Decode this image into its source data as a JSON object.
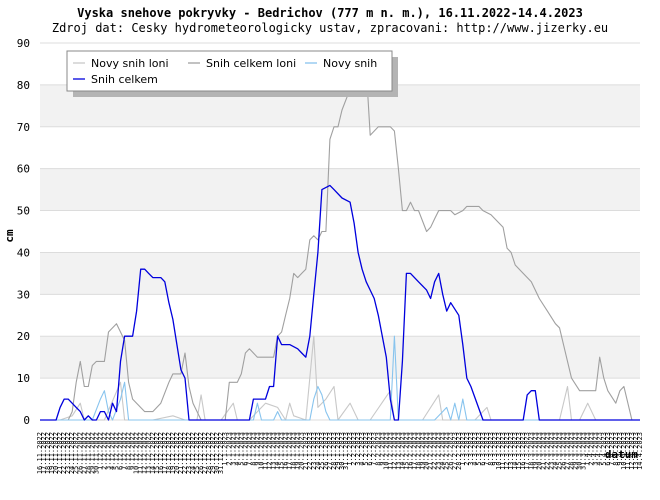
{
  "chart_data": {
    "type": "line",
    "title": "Vyska snehove pokryvky - Bedrichov (777 m n. m.), 16.11.2022-14.4.2023",
    "subtitle": "Zdroj dat: Cesky hydrometeorologicky ustav, zpracovani: http://www.jizerky.eu",
    "ylabel": "cm",
    "xlabel": "datum",
    "ylim": [
      0,
      90
    ],
    "yticks": [
      0,
      10,
      20,
      30,
      40,
      50,
      60,
      70,
      80,
      90
    ],
    "grid": true,
    "legend_position": "top-left",
    "x_start": "16.11.2022",
    "x_end": "14.4.2023",
    "series": [
      {
        "name": "Novy snih loni",
        "color": "#c8c8c8",
        "values": [
          [
            0,
            0
          ],
          [
            5,
            0
          ],
          [
            8,
            1
          ],
          [
            10,
            4
          ],
          [
            11,
            0
          ],
          [
            13,
            0
          ],
          [
            16,
            0
          ],
          [
            20,
            9
          ],
          [
            21,
            0
          ],
          [
            28,
            0
          ],
          [
            33,
            1
          ],
          [
            36,
            0
          ],
          [
            39,
            0
          ],
          [
            40,
            6
          ],
          [
            41,
            0
          ],
          [
            45,
            0
          ],
          [
            48,
            4
          ],
          [
            49,
            0
          ],
          [
            52,
            0
          ],
          [
            56,
            4
          ],
          [
            59,
            3
          ],
          [
            61,
            0
          ],
          [
            62,
            4
          ],
          [
            63,
            1
          ],
          [
            66,
            0
          ],
          [
            68,
            20
          ],
          [
            69,
            3
          ],
          [
            71,
            5
          ],
          [
            73,
            8
          ],
          [
            74,
            0
          ],
          [
            77,
            4
          ],
          [
            79,
            0
          ],
          [
            82,
            0
          ],
          [
            87,
            7
          ],
          [
            88,
            0
          ],
          [
            95,
            0
          ],
          [
            99,
            6
          ],
          [
            100,
            0
          ],
          [
            108,
            0
          ],
          [
            111,
            3
          ],
          [
            112,
            0
          ],
          [
            129,
            0
          ],
          [
            131,
            8
          ],
          [
            132,
            0
          ],
          [
            134,
            0
          ],
          [
            136,
            4
          ],
          [
            138,
            0
          ],
          [
            149,
            0
          ]
        ]
      },
      {
        "name": "Snih celkem loni",
        "color": "#a0a0a0",
        "values": [
          [
            0,
            0
          ],
          [
            7,
            0
          ],
          [
            8,
            2
          ],
          [
            9,
            9
          ],
          [
            10,
            14
          ],
          [
            11,
            8
          ],
          [
            12,
            8
          ],
          [
            13,
            13
          ],
          [
            14,
            14
          ],
          [
            16,
            14
          ],
          [
            17,
            21
          ],
          [
            19,
            23
          ],
          [
            21,
            19
          ],
          [
            22,
            9
          ],
          [
            23,
            5
          ],
          [
            24,
            4
          ],
          [
            26,
            2
          ],
          [
            28,
            2
          ],
          [
            30,
            4
          ],
          [
            32,
            9
          ],
          [
            33,
            11
          ],
          [
            35,
            11
          ],
          [
            36,
            16
          ],
          [
            37,
            8
          ],
          [
            38,
            4
          ],
          [
            40,
            0
          ],
          [
            46,
            0
          ],
          [
            47,
            9
          ],
          [
            49,
            9
          ],
          [
            50,
            11
          ],
          [
            51,
            16
          ],
          [
            52,
            17
          ],
          [
            54,
            15
          ],
          [
            58,
            15
          ],
          [
            59,
            20
          ],
          [
            60,
            21
          ],
          [
            61,
            25
          ],
          [
            62,
            29
          ],
          [
            63,
            35
          ],
          [
            64,
            34
          ],
          [
            65,
            35
          ],
          [
            66,
            36
          ],
          [
            67,
            43
          ],
          [
            68,
            44
          ],
          [
            69,
            43
          ],
          [
            70,
            45
          ],
          [
            71,
            45
          ],
          [
            72,
            67
          ],
          [
            73,
            70
          ],
          [
            74,
            70
          ],
          [
            75,
            74
          ],
          [
            77,
            79
          ],
          [
            78,
            80
          ],
          [
            79,
            80
          ],
          [
            81,
            84
          ],
          [
            82,
            68
          ],
          [
            84,
            70
          ],
          [
            87,
            70
          ],
          [
            88,
            69
          ],
          [
            89,
            60
          ],
          [
            90,
            50
          ],
          [
            91,
            50
          ],
          [
            92,
            52
          ],
          [
            93,
            50
          ],
          [
            94,
            50
          ],
          [
            96,
            45
          ],
          [
            97,
            46
          ],
          [
            98,
            48
          ],
          [
            99,
            50
          ],
          [
            102,
            50
          ],
          [
            103,
            49
          ],
          [
            105,
            50
          ],
          [
            106,
            51
          ],
          [
            109,
            51
          ],
          [
            110,
            50
          ],
          [
            112,
            49
          ],
          [
            114,
            47
          ],
          [
            115,
            46
          ],
          [
            116,
            41
          ],
          [
            117,
            40
          ],
          [
            118,
            37
          ],
          [
            120,
            35
          ],
          [
            122,
            33
          ],
          [
            124,
            29
          ],
          [
            126,
            26
          ],
          [
            128,
            23
          ],
          [
            129,
            22
          ],
          [
            130,
            18
          ],
          [
            132,
            10
          ],
          [
            134,
            7
          ],
          [
            138,
            7
          ],
          [
            139,
            15
          ],
          [
            140,
            10
          ],
          [
            141,
            7
          ],
          [
            143,
            4
          ],
          [
            144,
            7
          ],
          [
            145,
            8
          ],
          [
            146,
            4
          ],
          [
            147,
            0
          ],
          [
            149,
            0
          ]
        ]
      },
      {
        "name": "Novy snih",
        "color": "#88c4ee",
        "values": [
          [
            0,
            0
          ],
          [
            13,
            0
          ],
          [
            15,
            5
          ],
          [
            16,
            7
          ],
          [
            17,
            2
          ],
          [
            18,
            0
          ],
          [
            20,
            5
          ],
          [
            21,
            9
          ],
          [
            22,
            0
          ],
          [
            53,
            0
          ],
          [
            54,
            4
          ],
          [
            55,
            0
          ],
          [
            58,
            0
          ],
          [
            59,
            2
          ],
          [
            60,
            0
          ],
          [
            67,
            0
          ],
          [
            68,
            5
          ],
          [
            69,
            8
          ],
          [
            70,
            6
          ],
          [
            71,
            2
          ],
          [
            72,
            0
          ],
          [
            87,
            0
          ],
          [
            88,
            20
          ],
          [
            89,
            0
          ],
          [
            98,
            0
          ],
          [
            99,
            1
          ],
          [
            100,
            2
          ],
          [
            101,
            3
          ],
          [
            102,
            0
          ],
          [
            103,
            4
          ],
          [
            104,
            0
          ],
          [
            105,
            5
          ],
          [
            106,
            0
          ],
          [
            149,
            0
          ]
        ]
      },
      {
        "name": "Snih celkem",
        "color": "#0000dd",
        "values": [
          [
            0,
            0
          ],
          [
            4,
            0
          ],
          [
            5,
            3
          ],
          [
            6,
            5
          ],
          [
            7,
            5
          ],
          [
            9,
            3
          ],
          [
            10,
            2
          ],
          [
            11,
            0
          ],
          [
            12,
            1
          ],
          [
            13,
            0
          ],
          [
            14,
            0
          ],
          [
            15,
            2
          ],
          [
            16,
            2
          ],
          [
            17,
            0
          ],
          [
            18,
            4
          ],
          [
            19,
            2
          ],
          [
            20,
            14
          ],
          [
            21,
            20
          ],
          [
            23,
            20
          ],
          [
            24,
            26
          ],
          [
            25,
            36
          ],
          [
            26,
            36
          ],
          [
            27,
            35
          ],
          [
            28,
            34
          ],
          [
            30,
            34
          ],
          [
            31,
            33
          ],
          [
            32,
            28
          ],
          [
            33,
            24
          ],
          [
            34,
            18
          ],
          [
            35,
            12
          ],
          [
            36,
            10
          ],
          [
            37,
            0
          ],
          [
            52,
            0
          ],
          [
            53,
            5
          ],
          [
            56,
            5
          ],
          [
            57,
            8
          ],
          [
            58,
            8
          ],
          [
            59,
            20
          ],
          [
            60,
            18
          ],
          [
            62,
            18
          ],
          [
            64,
            17
          ],
          [
            65,
            16
          ],
          [
            66,
            15
          ],
          [
            67,
            20
          ],
          [
            68,
            30
          ],
          [
            69,
            40
          ],
          [
            70,
            55
          ],
          [
            72,
            56
          ],
          [
            73,
            55
          ],
          [
            75,
            53
          ],
          [
            77,
            52
          ],
          [
            78,
            47
          ],
          [
            79,
            40
          ],
          [
            80,
            36
          ],
          [
            81,
            33
          ],
          [
            82,
            31
          ],
          [
            83,
            29
          ],
          [
            84,
            25
          ],
          [
            85,
            20
          ],
          [
            86,
            15
          ],
          [
            87,
            5
          ],
          [
            88,
            0
          ],
          [
            89,
            0
          ],
          [
            90,
            14
          ],
          [
            91,
            35
          ],
          [
            92,
            35
          ],
          [
            94,
            33
          ],
          [
            96,
            31
          ],
          [
            97,
            29
          ],
          [
            98,
            33
          ],
          [
            99,
            35
          ],
          [
            100,
            30
          ],
          [
            101,
            26
          ],
          [
            102,
            28
          ],
          [
            104,
            25
          ],
          [
            105,
            18
          ],
          [
            106,
            10
          ],
          [
            107,
            8
          ],
          [
            110,
            0
          ],
          [
            120,
            0
          ],
          [
            121,
            6
          ],
          [
            122,
            7
          ],
          [
            123,
            7
          ],
          [
            124,
            0
          ],
          [
            149,
            0
          ]
        ]
      }
    ]
  }
}
